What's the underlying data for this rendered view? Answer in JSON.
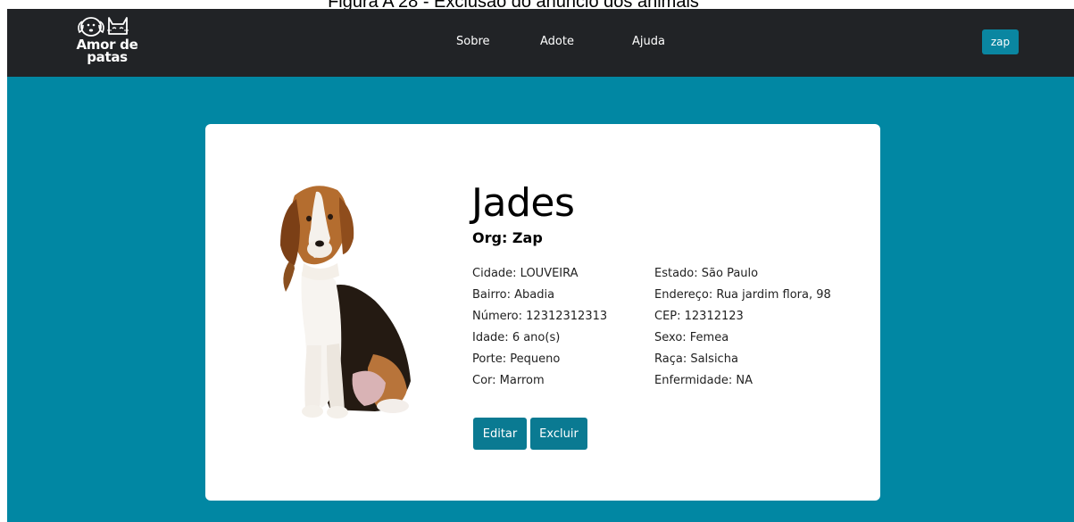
{
  "caption": "Figura A 28 - Exclusão do anúncio dos animais",
  "navbar": {
    "logo_line1": "Amor de",
    "logo_line2": "patas",
    "links": [
      "Sobre",
      "Adote",
      "Ajuda"
    ],
    "user_button": "zap"
  },
  "animal": {
    "name": "Jades",
    "org": "Org: Zap",
    "left_fields": [
      "Cidade: LOUVEIRA",
      "Bairro: Abadia",
      "Número: 12312312313",
      "Idade: 6 ano(s)",
      "Porte: Pequeno",
      "Cor: Marrom"
    ],
    "right_fields": [
      "Estado: São Paulo",
      "Endereço: Rua jardim flora, 98",
      "CEP: 12312123",
      "Sexo: Femea",
      "Raça: Salsicha",
      "Enfermidade: NA"
    ]
  },
  "actions": {
    "edit": "Editar",
    "delete": "Excluir"
  },
  "colors": {
    "navbar": "#212326",
    "background": "#0187a3",
    "button": "#0a7a92"
  },
  "icons": {
    "logo": "dog-and-cat-icon",
    "photo": "beagle-dog-photo"
  }
}
